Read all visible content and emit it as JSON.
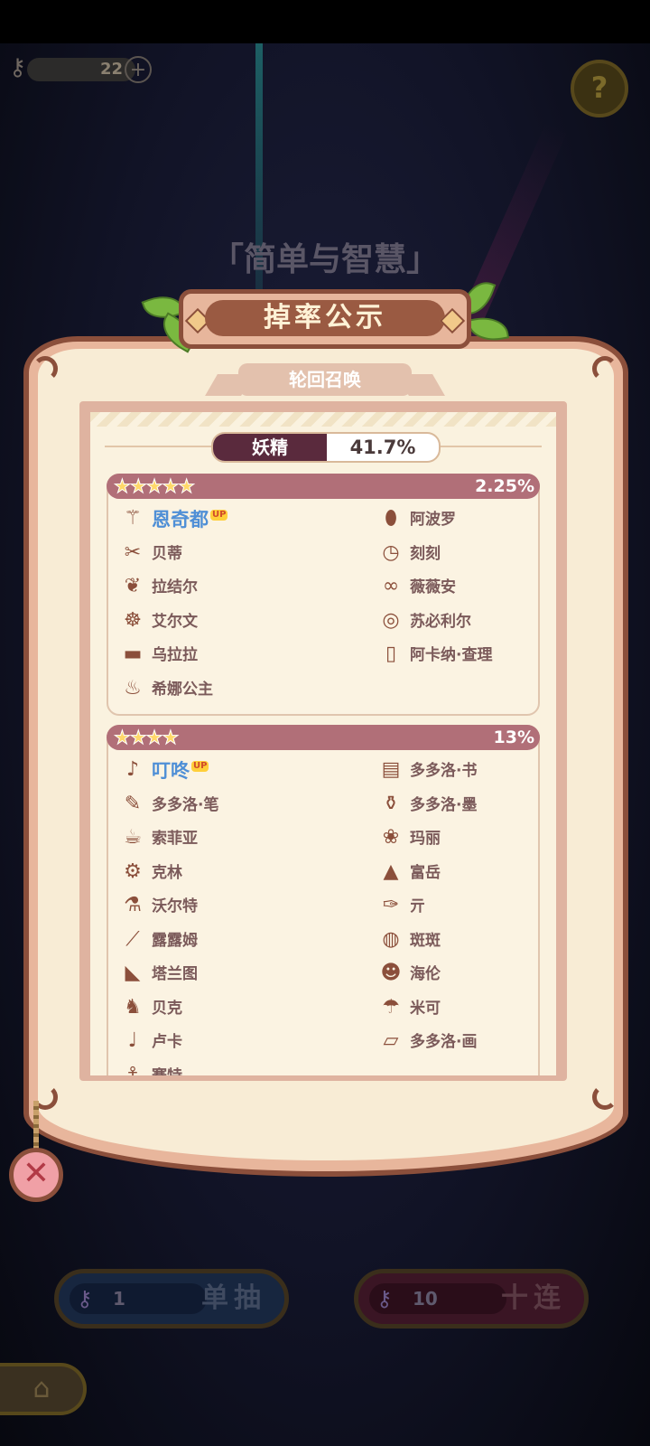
{
  "hud": {
    "key_count": "22",
    "plus_label": "+",
    "help_label": "?"
  },
  "pool_title": "「简单与智慧」",
  "panel": {
    "title": "掉率公示",
    "subtitle": "轮回召唤",
    "category": {
      "label": "妖精",
      "rate": "41.7%"
    }
  },
  "groups": [
    {
      "stars": "★★★★★",
      "rate": "2.25%",
      "items": [
        {
          "name": "恩奇都",
          "icon": "⚚",
          "up": true,
          "up_label": "UP"
        },
        {
          "name": "阿波罗",
          "icon": "⬮",
          "up": false
        },
        {
          "name": "贝蒂",
          "icon": "✂",
          "up": false
        },
        {
          "name": "刻刻",
          "icon": "◷",
          "up": false
        },
        {
          "name": "拉结尔",
          "icon": "❦",
          "up": false
        },
        {
          "name": "薇薇安",
          "icon": "∞",
          "up": false
        },
        {
          "name": "艾尔文",
          "icon": "☸",
          "up": false
        },
        {
          "name": "苏必利尔",
          "icon": "◎",
          "up": false
        },
        {
          "name": "乌拉拉",
          "icon": "▬",
          "up": false
        },
        {
          "name": "阿卡纳·查理",
          "icon": "▯",
          "up": false
        },
        {
          "name": "希娜公主",
          "icon": "♨",
          "up": false
        }
      ]
    },
    {
      "stars": "★★★★",
      "rate": "13%",
      "items": [
        {
          "name": "叮咚",
          "icon": "♪",
          "up": true,
          "up_label": "UP"
        },
        {
          "name": "多多洛·书",
          "icon": "▤",
          "up": false
        },
        {
          "name": "多多洛·笔",
          "icon": "✎",
          "up": false
        },
        {
          "name": "多多洛·墨",
          "icon": "⚱",
          "up": false
        },
        {
          "name": "索菲亚",
          "icon": "☕",
          "up": false
        },
        {
          "name": "玛丽",
          "icon": "❀",
          "up": false
        },
        {
          "name": "克林",
          "icon": "⚙",
          "up": false
        },
        {
          "name": "富岳",
          "icon": "▲",
          "up": false
        },
        {
          "name": "沃尔特",
          "icon": "⚗",
          "up": false
        },
        {
          "name": "亓",
          "icon": "✑",
          "up": false
        },
        {
          "name": "露露姆",
          "icon": "⟋",
          "up": false
        },
        {
          "name": "斑斑",
          "icon": "◍",
          "up": false
        },
        {
          "name": "塔兰图",
          "icon": "◣",
          "up": false
        },
        {
          "name": "海伦",
          "icon": "☻",
          "up": false
        },
        {
          "name": "贝克",
          "icon": "♞",
          "up": false
        },
        {
          "name": "米可",
          "icon": "☂",
          "up": false
        },
        {
          "name": "卢卡",
          "icon": "♩",
          "up": false
        },
        {
          "name": "多多洛·画",
          "icon": "▱",
          "up": false
        },
        {
          "name": "赛特",
          "icon": "⚓",
          "up": false
        }
      ]
    }
  ],
  "close_label": "✕",
  "buttons": {
    "single": {
      "cost": "1",
      "label": "单抽"
    },
    "ten": {
      "cost": "10",
      "label": "十连"
    }
  },
  "home_label": "⌂",
  "colors": {
    "panel_border": "#8b4f3b",
    "panel_fill": "#f8ecd5",
    "group_header": "#b16f78",
    "up_name": "#4f8fd6",
    "item_name": "#7b5a5a"
  }
}
